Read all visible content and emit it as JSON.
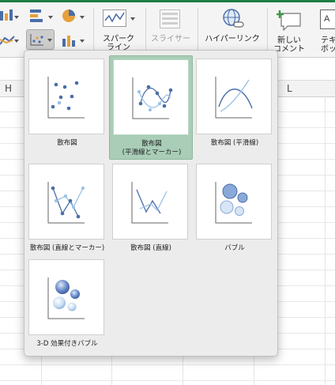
{
  "ribbon": {
    "sparkline_label": "スパーク\nライン",
    "slicer_label": "スライサー",
    "hyperlink_label": "ハイパーリンク",
    "new_comment_label": "新しい\nコメント",
    "textbox_label": "テキ\nボッ"
  },
  "sheet": {
    "column_h": "H",
    "column_l": "L"
  },
  "chart_menu": {
    "items": [
      {
        "label": "散布図"
      },
      {
        "label": "散布図\n(平滑線とマーカー)"
      },
      {
        "label": "散布図 (平滑線)"
      },
      {
        "label": "散布図 (直線とマーカー)"
      },
      {
        "label": "散布図 (直線)"
      },
      {
        "label": "バブル"
      },
      {
        "label": "3-D 効果付きバブル"
      }
    ]
  },
  "colors": {
    "accent_green": "#1f7d43",
    "selection_green": "#a9cdb7",
    "series_dark": "#4a6ea8",
    "series_light": "#9cc2e5"
  }
}
